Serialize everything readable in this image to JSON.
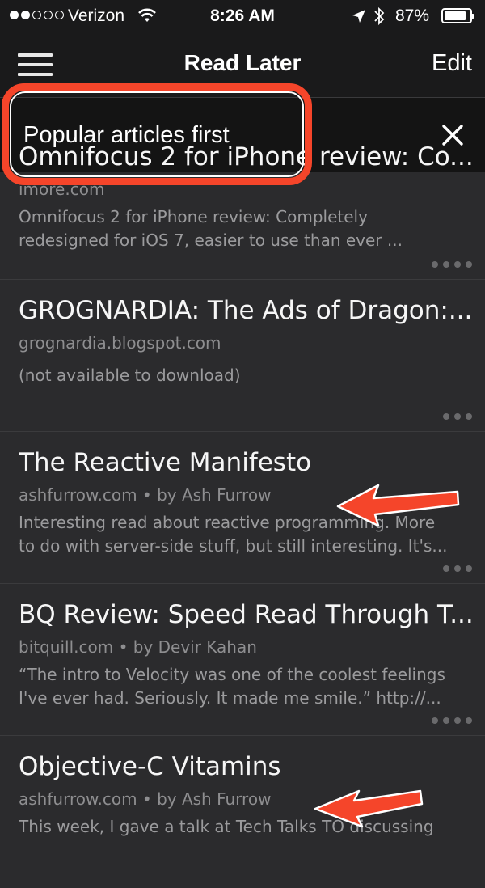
{
  "status_bar": {
    "carrier": "Verizon",
    "time": "8:26 AM",
    "battery": "87%",
    "battery_level": 0.87,
    "signal_bars_filled": 2,
    "signal_bars_total": 5,
    "icons": [
      "wifi-icon",
      "location-icon",
      "bluetooth-icon",
      "battery-icon"
    ]
  },
  "nav": {
    "title": "Read Later",
    "edit_label": "Edit",
    "menu_icon": "hamburger-menu-icon"
  },
  "filter": {
    "label": "Popular articles first",
    "close_icon": "close-icon",
    "close_glyph": "✕"
  },
  "annotation_color": "#f5452a",
  "articles": [
    {
      "title": "Omnifocus 2 for iPhone review: Co...",
      "source": "imore.com",
      "excerpt": [
        "Omnifocus 2 for iPhone review: Completely",
        "redesigned for iOS 7, easier to use than ever ..."
      ],
      "more_icon": "more-dots-icon"
    },
    {
      "title": "GROGNARDIA: The Ads of Dragon:...",
      "source": "grognardia.blogspot.com",
      "excerpt": [
        "(not available to download)"
      ],
      "more_icon": "more-dots-icon"
    },
    {
      "title": "The Reactive Manifesto",
      "source": "ashfurrow.com • by Ash Furrow",
      "excerpt": [
        "Interesting read about reactive programming. More",
        "to do with server-side stuff, but still interesting. It's..."
      ],
      "more_icon": "more-dots-icon",
      "annotated": true
    },
    {
      "title": "BQ Review: Speed Read Through T...",
      "source": "bitquill.com • by Devir Kahan",
      "excerpt": [
        "“The intro to Velocity was one of the coolest feelings",
        "I've ever had. Seriously. It made me smile.” http://..."
      ],
      "more_icon": "more-dots-icon"
    },
    {
      "title": "Objective-C Vitamins",
      "source": "ashfurrow.com • by Ash Furrow",
      "excerpt": [
        "This week, I gave a talk at Tech Talks TO discussing"
      ],
      "more_icon": "more-dots-icon",
      "annotated": true
    }
  ]
}
